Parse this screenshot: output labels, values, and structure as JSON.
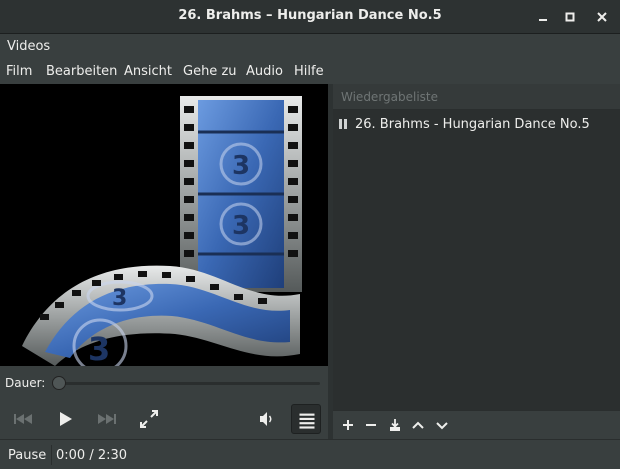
{
  "window": {
    "title": "26. Brahms – Hungarian Dance No.5",
    "buttons": [
      "minimize-icon",
      "maximize-icon",
      "close-icon"
    ]
  },
  "app_menu": {
    "label": "Videos"
  },
  "menubar": [
    "Film",
    "Bearbeiten",
    "Ansicht",
    "Gehe zu",
    "Audio",
    "Hilfe"
  ],
  "playlist": {
    "header": "Wiedergabeliste",
    "items": [
      {
        "state": "paused",
        "label": "26. Brahms - Hungarian Dance No.5"
      }
    ],
    "tools": [
      "add-icon",
      "remove-icon",
      "save-icon",
      "move-up-icon",
      "move-down-icon"
    ]
  },
  "seek": {
    "label": "Dauer:",
    "progress": 0.0
  },
  "controls": {
    "icons": [
      "previous-icon",
      "play-icon",
      "next-icon",
      "fullscreen-icon",
      "volume-icon",
      "playlist-toggle-icon"
    ]
  },
  "status": {
    "state": "Pause",
    "time": "0:00 / 2:30"
  },
  "colors": {
    "background": "#393f3f",
    "titlebar": "#2d3232",
    "accent": "#4a90d9",
    "film_blue": "#3f6fb8"
  }
}
